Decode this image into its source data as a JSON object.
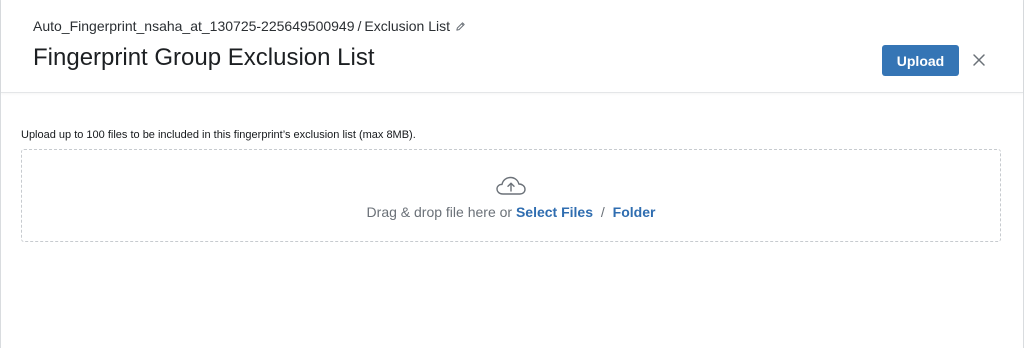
{
  "header": {
    "breadcrumb": {
      "fingerprint_name": "Auto_Fingerprint_nsaha_at_130725-225649500949",
      "separator": "/",
      "current": "Exclusion List",
      "edit_icon": "pencil-icon"
    },
    "title": "Fingerprint Group Exclusion List",
    "upload_label": "Upload",
    "close_icon": "close-icon"
  },
  "main": {
    "instructions": "Upload up to 100 files to be included in this fingerprint’s exclusion list (max 8MB).",
    "dropzone": {
      "icon": "cloud-upload-icon",
      "prompt": "Drag & drop file here or",
      "select_files_label": "Select Files",
      "separator": "/",
      "folder_label": "Folder"
    }
  },
  "colors": {
    "primary": "#3575b5",
    "link": "#2f6db0",
    "muted_text": "#6b7178",
    "border": "#c7cbcf"
  }
}
